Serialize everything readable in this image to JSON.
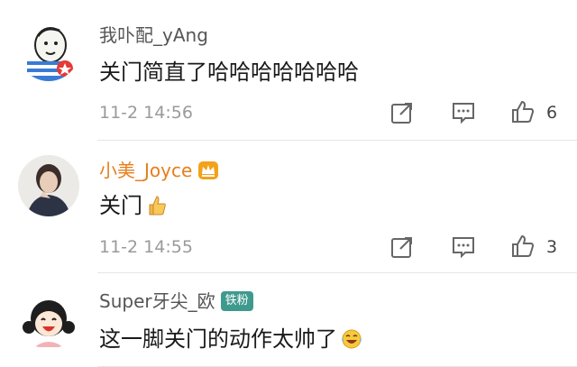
{
  "comments": [
    {
      "username": "我卟配_yAng",
      "text": "关门简直了哈哈哈哈哈哈哈",
      "time": "11-2 14:56",
      "likes": "6",
      "avatar_icon": "cartoon-sketch-avatar"
    },
    {
      "username": "小美_Joyce",
      "text": "关门",
      "time": "11-2 14:55",
      "likes": "3",
      "avatar_icon": "photo-avatar",
      "username_color": "#e67e1b",
      "badge_icon": "crown-icon",
      "emoji_icon": "thumbs-up-emoji"
    },
    {
      "username": "Super牙尖_欧",
      "text": "这一脚关门的动作太帅了",
      "badge_text": "铁粉",
      "avatar_icon": "cartoon-girl-avatar",
      "emoji_icon": "laughing-tears-emoji"
    }
  ],
  "colors": {
    "badge_fan": "#3f9a8e",
    "meta": "#9a9a9a"
  }
}
